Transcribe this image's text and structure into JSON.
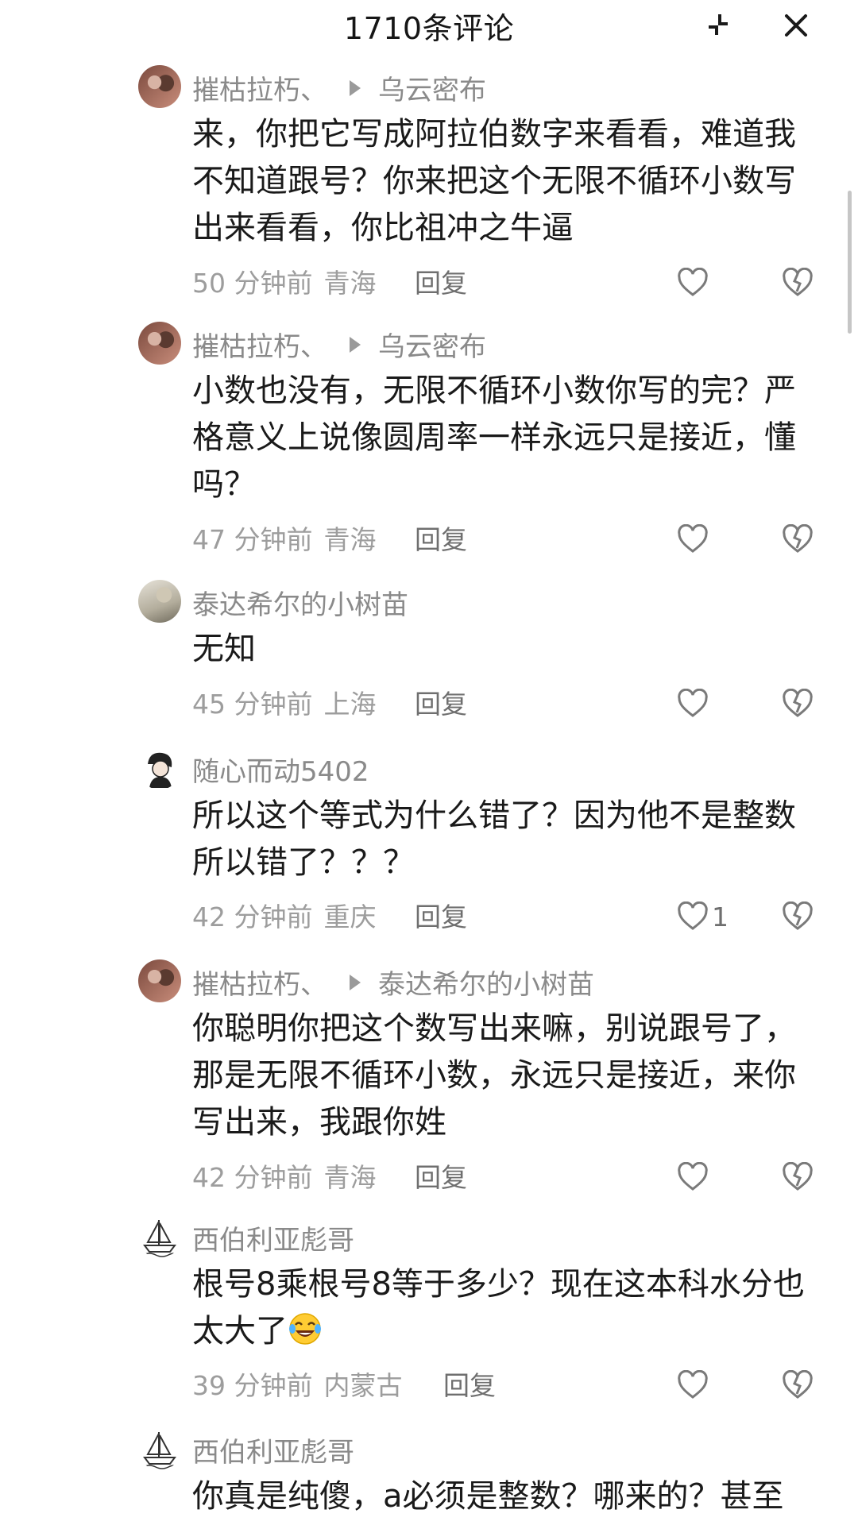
{
  "header": {
    "title": "1710条评论",
    "collapse_icon": "collapse-icon",
    "close_icon": "close-icon"
  },
  "comments": [
    {
      "user": "摧枯拉朽、",
      "reply_to": "乌云密布",
      "text": "来，你把它写成阿拉伯数字来看看，难道我不知道跟号？你来把这个无限不循环小数写出来看看，你比祖冲之牛逼",
      "time": "50 分钟前",
      "location": "青海",
      "reply_label": "回复",
      "likes": ""
    },
    {
      "user": "摧枯拉朽、",
      "reply_to": "乌云密布",
      "text": "小数也没有，无限不循环小数你写的完？严格意义上说像圆周率一样永远只是接近，懂吗？",
      "time": "47 分钟前",
      "location": "青海",
      "reply_label": "回复",
      "likes": ""
    },
    {
      "user": "泰达希尔的小树苗",
      "reply_to": "",
      "text": "无知",
      "time": "45 分钟前",
      "location": "上海",
      "reply_label": "回复",
      "likes": ""
    },
    {
      "user": "随心而动5402",
      "reply_to": "",
      "text": "所以这个等式为什么错了？因为他不是整数所以错了？？？",
      "time": "42 分钟前",
      "location": "重庆",
      "reply_label": "回复",
      "likes": "1"
    },
    {
      "user": "摧枯拉朽、",
      "reply_to": "泰达希尔的小树苗",
      "text": "你聪明你把这个数写出来嘛，别说跟号了，那是无限不循环小数，永远只是接近，来你写出来，我跟你姓",
      "time": "42 分钟前",
      "location": "青海",
      "reply_label": "回复",
      "likes": ""
    },
    {
      "user": "西伯利亚彪哥",
      "reply_to": "",
      "text": "根号8乘根号8等于多少？现在这本科水分也太大了",
      "emoji": "laughing-tears-emoji",
      "time": "39 分钟前",
      "location": "内蒙古",
      "reply_label": "回复",
      "likes": ""
    },
    {
      "user": "西伯利亚彪哥",
      "reply_to": "",
      "text": "你真是纯傻，a必须是整数？哪来的？甚至",
      "time": "",
      "location": "",
      "reply_label": "",
      "likes": ""
    }
  ]
}
